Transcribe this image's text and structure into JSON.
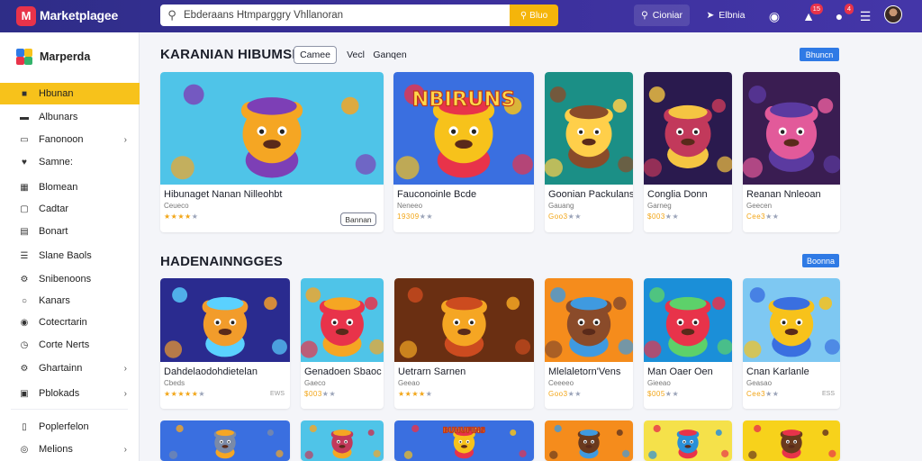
{
  "topbar": {
    "logo_letter": "M",
    "brand": "Marketplagee",
    "search_placeholder": "Ebderaans Htmparggry Vhllanoran",
    "search_button": "Bluo",
    "search_btn2": "Cioniar",
    "user_label": "Elbnia",
    "notif_badge": "15",
    "msg_badge": "4"
  },
  "sidebar": {
    "brand": "Marperda",
    "items": [
      {
        "label": "Hbunan",
        "icon": "home-icon",
        "active": true,
        "chevron": false
      },
      {
        "label": "Albunars",
        "icon": "folder-icon",
        "active": false,
        "chevron": false
      },
      {
        "label": "Fanonoon",
        "icon": "card-icon",
        "active": false,
        "chevron": true
      },
      {
        "label": "Samne:",
        "icon": "heart-icon",
        "active": false,
        "chevron": false
      },
      {
        "label": "Blomean",
        "icon": "grid-icon",
        "active": false,
        "chevron": false
      },
      {
        "label": "Cadtar",
        "icon": "box-icon",
        "active": false,
        "chevron": false
      },
      {
        "label": "Bonart",
        "icon": "calendar-icon",
        "active": false,
        "chevron": false
      },
      {
        "label": "Slane Baols",
        "icon": "list-icon",
        "active": false,
        "chevron": false
      },
      {
        "label": "Snibenoons",
        "icon": "gear-icon",
        "active": false,
        "chevron": false
      },
      {
        "label": "Kanars",
        "icon": "circle-icon",
        "active": false,
        "chevron": false
      },
      {
        "label": "Cotecrtarin",
        "icon": "chat-icon",
        "active": false,
        "chevron": false
      },
      {
        "label": "Corte Nerts",
        "icon": "clock-icon",
        "active": false,
        "chevron": false
      },
      {
        "label": "Ghartainn",
        "icon": "settings-icon",
        "active": false,
        "chevron": true
      },
      {
        "label": "Pblokads",
        "icon": "image-icon",
        "active": false,
        "chevron": true
      },
      {
        "label": "Poplerfelon",
        "icon": "doc-icon",
        "active": false,
        "chevron": false
      },
      {
        "label": "Melions",
        "icon": "badge-icon",
        "active": false,
        "chevron": true
      }
    ]
  },
  "section1": {
    "title": "KARANIAN HIBUMSIA",
    "tabs": [
      "Camee",
      "Vecl",
      "Ganqen"
    ],
    "button": "Bhuncn",
    "cards": [
      {
        "title": "Hibunaget Nanan Nilleohbt",
        "sub": "Ceueco",
        "stars": "★★★★",
        "dim": "★",
        "btn": "Bannan",
        "palette": [
          "#4fc4e8",
          "#f5a623",
          "#7d3fb6"
        ],
        "big": true
      },
      {
        "title": "Fauconoinle Bcde",
        "sub": "Neneeo",
        "stars": "19309",
        "dim": "★★",
        "palette": [
          "#3a6fe0",
          "#f7c21b",
          "#e8334a"
        ],
        "text": "NBIRUNS"
      },
      {
        "title": "Goonian Packulans",
        "sub": "Gauang",
        "stars": "Goo3",
        "dim": "★★",
        "palette": [
          "#1b8f86",
          "#ffcf4a",
          "#8a4b2a"
        ]
      },
      {
        "title": "Conglia Donn",
        "sub": "Garneg",
        "stars": "$003",
        "dim": "★★",
        "palette": [
          "#2a1a4e",
          "#c2395b",
          "#f5c542"
        ]
      },
      {
        "title": "Reanan Nnleoan",
        "sub": "Geecen",
        "stars": "Cee3",
        "dim": "★★",
        "palette": [
          "#3a1d52",
          "#e25a9a",
          "#5b3aa0"
        ]
      }
    ]
  },
  "section2": {
    "title": "HADENAINNGGES",
    "button": "Boonna",
    "cards": [
      {
        "title": "Dahdelaodohdietelan",
        "sub": "Cbeds",
        "stars": "★★★★★",
        "dim": "★",
        "ext": "EWS",
        "palette": [
          "#2a2b8f",
          "#f29c2b",
          "#5ad1ff"
        ]
      },
      {
        "title": "Genadoen Sbaoc",
        "sub": "Gaeco",
        "stars": "$003",
        "dim": "★★",
        "palette": [
          "#4fc4e8",
          "#e8334a",
          "#f5a623"
        ]
      },
      {
        "title": "Uetrarn Sarnen",
        "sub": "Geeao",
        "stars": "★★★★",
        "dim": "★",
        "palette": [
          "#6a2f12",
          "#f5a623",
          "#cc4b1f"
        ]
      },
      {
        "title": "Mlelaletorn'Vens",
        "sub": "Ceeeeo",
        "stars": "Goo3",
        "dim": "★★",
        "palette": [
          "#f58c1c",
          "#8a4b2a",
          "#3f9ae0"
        ]
      },
      {
        "title": "Man Oaer Oen",
        "sub": "Gieeao",
        "stars": "$005",
        "dim": "★★",
        "palette": [
          "#1b8fd8",
          "#e8334a",
          "#5dd16a"
        ]
      },
      {
        "title": "Cnan Karlanle",
        "sub": "Geasao",
        "stars": "Cee3",
        "dim": "★★",
        "ext": "ESS",
        "palette": [
          "#7ec8f2",
          "#f7c21b",
          "#3a6fe0"
        ]
      }
    ]
  },
  "section3": {
    "cards": [
      {
        "palette": [
          "#3a6fe0",
          "#7a8aa8",
          "#f5a623"
        ]
      },
      {
        "palette": [
          "#4fc4e8",
          "#c2395b",
          "#f5a623"
        ]
      },
      {
        "palette": [
          "#3a6fe0",
          "#f7c21b",
          "#e8334a"
        ],
        "text": "BUHUFINS"
      },
      {
        "palette": [
          "#f58c1c",
          "#6a3a1e",
          "#3f9ae0"
        ]
      },
      {
        "palette": [
          "#f5e14a",
          "#2a8fd8",
          "#e8334a"
        ]
      },
      {
        "palette": [
          "#f7d21b",
          "#6a3a1e",
          "#e8334a"
        ]
      }
    ]
  },
  "colors": {
    "accent": "#f7c21b",
    "topbar": "#2e2d87",
    "button_blue": "#2f7ae5",
    "badge_red": "#e8334a"
  }
}
